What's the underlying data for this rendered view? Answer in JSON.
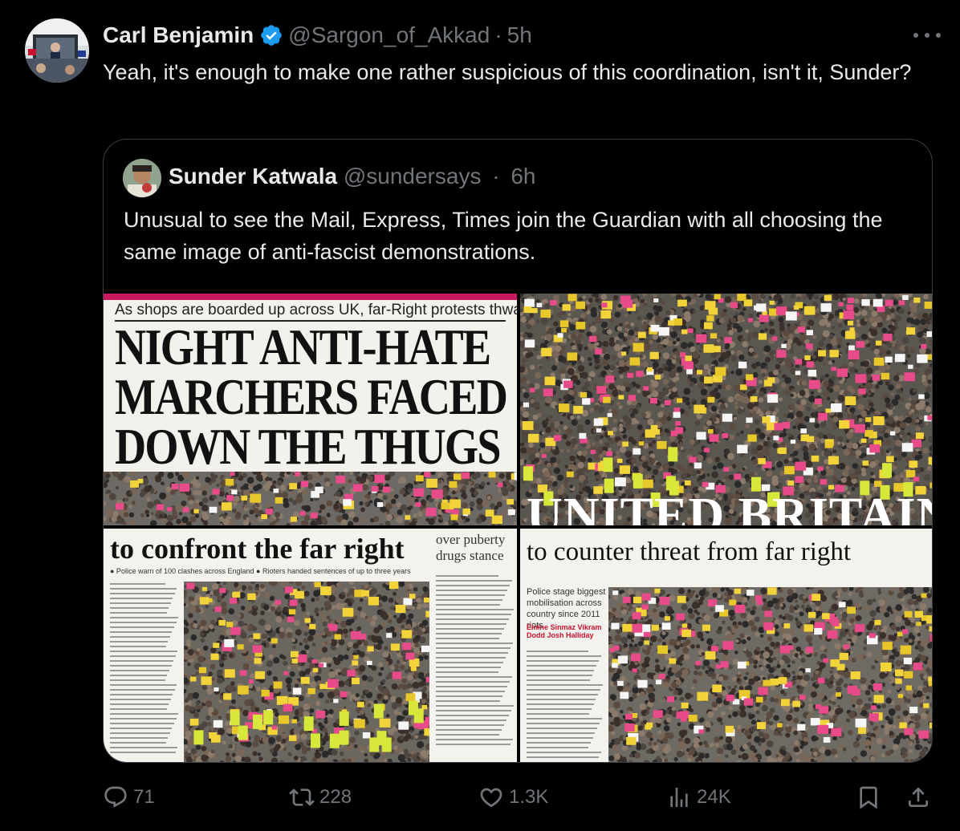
{
  "tweet": {
    "author_name": "Carl Benjamin",
    "handle": "@Sargon_of_Akkad",
    "separator": "·",
    "time": "5h",
    "text": "Yeah, it's enough to make one rather suspicious of this coordination, isn't it, Sunder?",
    "verified_color": "#1d9bf0"
  },
  "quoted": {
    "author_name": "Sunder Katwala",
    "handle": "@sundersays",
    "separator": "·",
    "time": "6h",
    "text": "Unusual to see the Mail, Express, Times join the Guardian with all choosing the same image of anti-fascist demonstrations.",
    "images": [
      {
        "kicker": "As shops are boarded up across UK, far-Right protests thwarted",
        "headline_1": "NIGHT ANTI-HATE",
        "headline_2": "MARCHERS FACED",
        "headline_3": "DOWN THE THUGS"
      },
      {
        "banner": "UNITED BRITAIN"
      },
      {
        "headline": "to confront the far right",
        "sidehead": "over puberty drugs stance",
        "subline": "● Police warn of 100 clashes across England ● Rioters handed sentences of up to three years"
      },
      {
        "headline": "to counter threat from far right",
        "standfirst": "Police stage biggest mobilisation across country since 2011 riots",
        "byline": "Emine Sinmaz Vikram Dodd Josh Halliday"
      }
    ]
  },
  "actions": {
    "replies": "71",
    "reposts": "228",
    "likes": "1.3K",
    "views": "24K"
  },
  "icons": [
    "more-icon",
    "verified-icon",
    "reply-icon",
    "repost-icon",
    "like-icon",
    "views-icon",
    "bookmark-icon",
    "share-icon"
  ]
}
